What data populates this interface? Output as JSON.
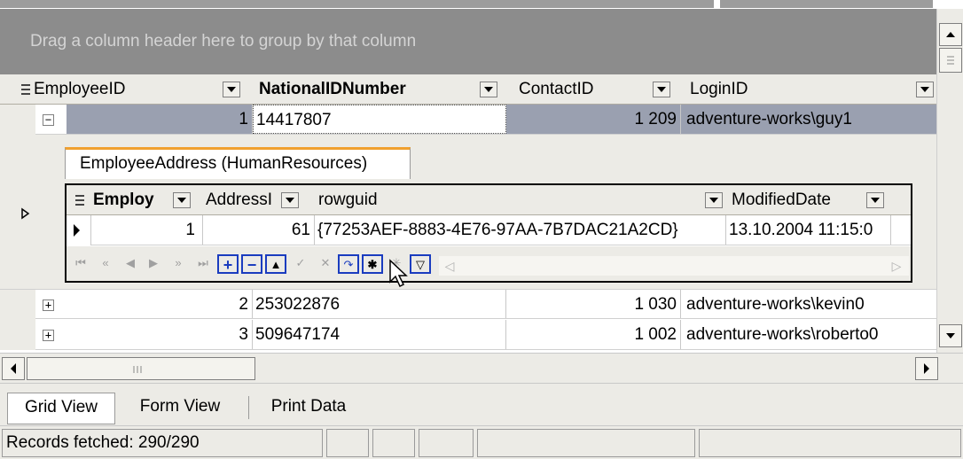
{
  "group_panel": {
    "text": "Drag a column header here to group by that column"
  },
  "master_headers": {
    "col1": "EmployeeID",
    "col2": "NationalIDNumber",
    "col3": "ContactID",
    "col4": "LoginID"
  },
  "master_rows": [
    {
      "employee_id": "1",
      "national_id": "14417807",
      "contact_id": "1 209",
      "login_id": "adventure-works\\guy1",
      "expanded": true
    },
    {
      "employee_id": "2",
      "national_id": "253022876",
      "contact_id": "1 030",
      "login_id": "adventure-works\\kevin0",
      "expanded": false
    },
    {
      "employee_id": "3",
      "national_id": "509647174",
      "contact_id": "1 002",
      "login_id": "adventure-works\\roberto0",
      "expanded": false
    }
  ],
  "detail": {
    "tab_label": "EmployeeAddress (HumanResources)",
    "headers": {
      "col1": "Employ",
      "col2": "AddressI",
      "col3": "rowguid",
      "col4": "ModifiedDate"
    },
    "row": {
      "employee_id": "1",
      "address_id": "61",
      "rowguid": "{77253AEF-8883-4E76-97AA-7B7DAC21A2CD}",
      "modified_date": "13.10.2004 11:15:0"
    }
  },
  "bottom_tabs": {
    "grid_view": "Grid View",
    "form_view": "Form View",
    "print_data": "Print Data"
  },
  "status": {
    "records": "Records fetched: 290/290"
  },
  "colors": {
    "group_panel_bg": "#8c8c8c",
    "selected_row": "#9aa0b0",
    "tab_accent": "#f0a030",
    "nav_blue": "#1a3cbf"
  },
  "icons": [
    "drag-grip-icon",
    "chevron-down-icon",
    "minus-box-icon",
    "plus-box-icon",
    "row-pointer-icon",
    "first-record-icon",
    "prev-page-icon",
    "prev-record-icon",
    "next-record-icon",
    "next-page-icon",
    "last-record-icon",
    "insert-icon",
    "delete-icon",
    "edit-icon",
    "post-icon",
    "cancel-icon",
    "refresh-icon",
    "bookmark-icon",
    "filter-icon",
    "arrow-up-icon",
    "arrow-down-icon",
    "arrow-left-icon",
    "arrow-right-icon",
    "mouse-cursor-icon"
  ]
}
